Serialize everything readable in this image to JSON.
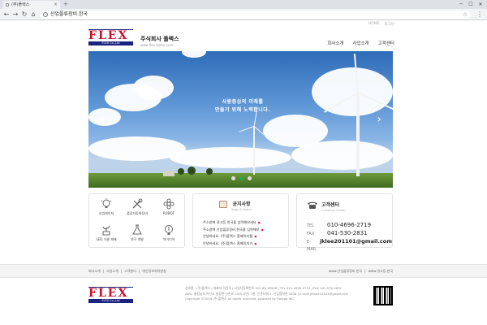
{
  "browser": {
    "tab_title": "(주)플렉스",
    "url": "산업플류장비.한국",
    "new_tab_symbol": "+",
    "close_symbol": "×",
    "window_controls": [
      "─",
      "☐",
      "✕"
    ]
  },
  "header": {
    "top_links": [
      "HOME",
      "로그인"
    ],
    "logo_text": "FLEX",
    "logo_subtext": "FLEX Co.,Ltd",
    "company_name": "주식회사 플렉스",
    "company_url": "www.flex-korea.com",
    "nav": [
      "회사소개",
      "사업소개",
      "고객센터"
    ]
  },
  "hero": {
    "caption_line1": "사람중심의 미래를",
    "caption_line2": "만들기 위해 노력합니다.",
    "prev_symbol": "‹",
    "next_symbol": "›",
    "slide_count": 3,
    "active_slide": 2
  },
  "services": [
    {
      "label": "산업레이저",
      "icon": "lightbulb-icon"
    },
    {
      "label": "플류자동화장비",
      "icon": "tools-icon"
    },
    {
      "label": "ROBOT",
      "icon": "flower-icon"
    },
    {
      "label": "LED 식물 재배",
      "icon": "plant-icon"
    },
    {
      "label": "연구 개발",
      "icon": "flask-icon"
    },
    {
      "label": "아이디어",
      "icon": "idea-icon"
    }
  ],
  "notice": {
    "title": "공지사항",
    "subtitle": "News & Notice",
    "new_badge": "●",
    "items": [
      "주소창에 경고등 한국을 입력해보세요",
      "주소창에 산업플류장비.한국을 입력해보",
      "안녕하세요. (주)플렉스 홈페이지를",
      "안녕하세요. (주)플렉스 홈페이지가"
    ]
  },
  "contact": {
    "title": "고객센터",
    "subtitle": "Customer Center",
    "tel_label": "TEL",
    "tel": "010-4696-2719",
    "fax_label": "FAX",
    "fax": "041-530-2831",
    "email_label": "E-MAIL",
    "email": "jklee201101@gmail.com"
  },
  "footer": {
    "links": [
      "회사소개",
      "사업소개",
      "고객센터",
      "개인정보처리방침"
    ],
    "separator": "|",
    "right_links": [
      "www.산업플류장비.한국",
      "www.경고등.한국"
    ],
    "info_lines": [
      "상호명 : (주)플렉스 | 대표자 이진덕 | 사업자등록번호 312-86-36948 | TEL 010-4696-2719 | FAX 041-530-2831",
      "ADD. 충청남도 아산시 청정면 신촌로 23(도고면) 7층, 신촌타워 2, 산업협력관 4208 | E-mail jklee201101@gmail.com",
      "Copyright ©2016 (주)플렉스 All rights reserved. powered by Sompo INC."
    ]
  },
  "colors": {
    "brand_red": "#c8102e",
    "brand_navy": "#1a237e",
    "active_dot": "#2fa84f"
  }
}
